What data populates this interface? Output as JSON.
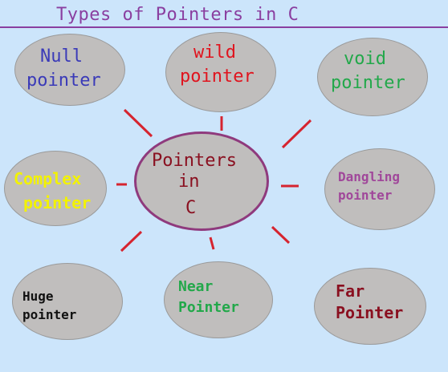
{
  "title": "Types of Pointers in C",
  "colors": {
    "background": "#cce5fb",
    "bubble_fill": "#c0bebd",
    "rule": "#8a3fa0",
    "rays": "#d6242f",
    "center_border": "#8f3a7d"
  },
  "center": {
    "line1": "Pointers",
    "line2": "in",
    "line3": "C"
  },
  "nodes": [
    {
      "line1": "Null",
      "line2": "pointer",
      "color": "#3a3ab8"
    },
    {
      "line1": "wild",
      "line2": "pointer",
      "color": "#e0141e"
    },
    {
      "line1": "void",
      "line2": "pointer",
      "color": "#22a84a"
    },
    {
      "line1": "Complex",
      "line2": "pointer",
      "color": "#f2f200"
    },
    {
      "line1": "Dangling",
      "line2": "pointer",
      "color": "#a0479a"
    },
    {
      "line1": "Huge",
      "line2": "pointer",
      "color": "#111111"
    },
    {
      "line1": "Near",
      "line2": "Pointer",
      "color": "#22a84a"
    },
    {
      "line1": "Far",
      "line2": "Pointer",
      "color": "#8a1020"
    }
  ]
}
